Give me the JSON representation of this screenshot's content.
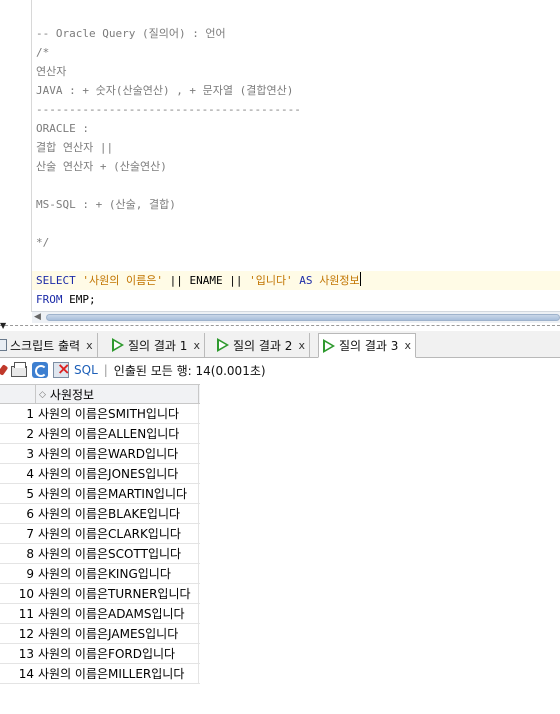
{
  "editor": {
    "lines": [
      {
        "segments": [
          {
            "t": "-- Oracle Query (질의어) : 언어",
            "c": "comment"
          }
        ]
      },
      {
        "segments": [
          {
            "t": "/*",
            "c": "comment"
          }
        ]
      },
      {
        "segments": [
          {
            "t": "연산자",
            "c": "comment"
          }
        ]
      },
      {
        "segments": [
          {
            "t": "JAVA : + 숫자(산술연산) , + 문자열 (결합연산)",
            "c": "comment"
          }
        ]
      },
      {
        "segments": [
          {
            "t": "----------------------------------------",
            "c": "comment"
          }
        ]
      },
      {
        "segments": [
          {
            "t": "ORACLE :",
            "c": "comment"
          }
        ]
      },
      {
        "segments": [
          {
            "t": "결합 연산자 ||",
            "c": "comment"
          }
        ]
      },
      {
        "segments": [
          {
            "t": "산술 연산자 + (산술연산)",
            "c": "comment"
          }
        ]
      },
      {
        "segments": []
      },
      {
        "segments": [
          {
            "t": "MS-SQL : + (산술, 결합)",
            "c": "comment"
          }
        ]
      },
      {
        "segments": []
      },
      {
        "segments": [
          {
            "t": "*/",
            "c": "comment"
          }
        ]
      },
      {
        "segments": []
      },
      {
        "segments": [
          {
            "t": "SELECT ",
            "c": "kw"
          },
          {
            "t": "'사원의 이름은'",
            "c": "str"
          },
          {
            "t": " || ",
            "c": "plain"
          },
          {
            "t": "ENAME",
            "c": "plain"
          },
          {
            "t": " || ",
            "c": "plain"
          },
          {
            "t": "'입니다'",
            "c": "str"
          },
          {
            "t": " AS ",
            "c": "kw"
          },
          {
            "t": "사원정보",
            "c": "str"
          }
        ],
        "caret": true
      },
      {
        "segments": [
          {
            "t": "FROM ",
            "c": "kw"
          },
          {
            "t": "EMP;",
            "c": "plain"
          }
        ]
      }
    ]
  },
  "tabs": [
    {
      "label": "스크립트 출력",
      "icon": "script-output-icon",
      "active": false
    },
    {
      "label": "질의 결과 1",
      "icon": "run-query-icon",
      "active": false
    },
    {
      "label": "질의 결과 2",
      "icon": "run-query-icon",
      "active": false
    },
    {
      "label": "질의 결과 3",
      "icon": "run-query-icon",
      "active": true
    }
  ],
  "tab_close_glyph": "x",
  "toolbar": {
    "sql_label": "SQL",
    "separator": "|",
    "fetch_status": "인출된 모든 행: 14(0.001초)"
  },
  "grid": {
    "column_header": "사원정보",
    "rows": [
      {
        "n": "1",
        "v": "사원의 이름은SMITH입니다"
      },
      {
        "n": "2",
        "v": "사원의 이름은ALLEN입니다"
      },
      {
        "n": "3",
        "v": "사원의 이름은WARD입니다"
      },
      {
        "n": "4",
        "v": "사원의 이름은JONES입니다"
      },
      {
        "n": "5",
        "v": "사원의 이름은MARTIN입니다"
      },
      {
        "n": "6",
        "v": "사원의 이름은BLAKE입니다"
      },
      {
        "n": "7",
        "v": "사원의 이름은CLARK입니다"
      },
      {
        "n": "8",
        "v": "사원의 이름은SCOTT입니다"
      },
      {
        "n": "9",
        "v": "사원의 이름은KING입니다"
      },
      {
        "n": "10",
        "v": "사원의 이름은TURNER입니다"
      },
      {
        "n": "11",
        "v": "사원의 이름은ADAMS입니다"
      },
      {
        "n": "12",
        "v": "사원의 이름은JAMES입니다"
      },
      {
        "n": "13",
        "v": "사원의 이름은FORD입니다"
      },
      {
        "n": "14",
        "v": "사원의 이름은MILLER입니다"
      }
    ]
  }
}
